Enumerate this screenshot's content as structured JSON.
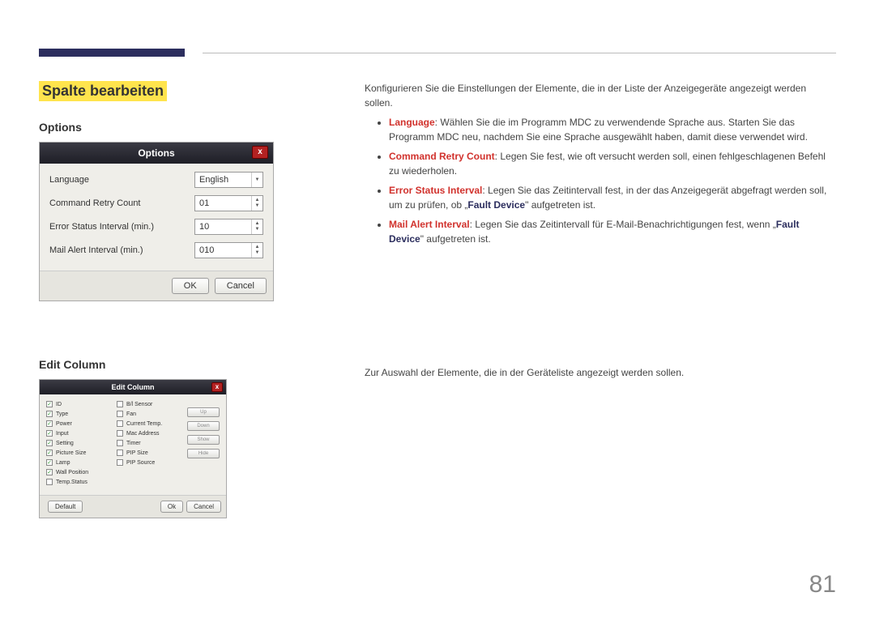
{
  "page": {
    "number": "81"
  },
  "headings": {
    "main": "Spalte bearbeiten",
    "options": "Options",
    "editcolumn": "Edit Column"
  },
  "dialogs": {
    "options": {
      "title": "Options",
      "rows": {
        "language_label": "Language",
        "language_value": "English",
        "retry_label": "Command Retry Count",
        "retry_value": "01",
        "errstatus_label": "Error Status Interval (min.)",
        "errstatus_value": "10",
        "mailalert_label": "Mail Alert Interval (min.)",
        "mailalert_value": "010"
      },
      "ok": "OK",
      "cancel": "Cancel"
    },
    "editcol": {
      "title": "Edit Column",
      "col1": [
        "ID",
        "Type",
        "Power",
        "Input",
        "Setting",
        "Picture Size",
        "Lamp",
        "Wall Position",
        "Temp.Status"
      ],
      "col1_checked": [
        true,
        true,
        true,
        true,
        true,
        true,
        true,
        true,
        false
      ],
      "col2": [
        "B/l Sensor",
        "Fan",
        "Current Temp.",
        "Mac Address",
        "Timer",
        "PIP Size",
        "PIP Source"
      ],
      "col2_checked": [
        false,
        false,
        false,
        false,
        false,
        false,
        false
      ],
      "btns": {
        "up": "Up",
        "down": "Down",
        "show": "Show",
        "hide": "Hide"
      },
      "default": "Default",
      "ok": "Ok",
      "cancel": "Cancel"
    }
  },
  "body": {
    "intro": "Konfigurieren Sie die Einstellungen der Elemente, die in der Liste der Anzeigegeräte angezeigt werden sollen.",
    "language_key": "Language",
    "language_text": ": Wählen Sie die im Programm MDC zu verwendende Sprache aus. Starten Sie das Programm MDC neu, nachdem Sie eine Sprache ausgewählt haben, damit diese verwendet wird.",
    "retry_key": "Command Retry Count",
    "retry_text": ": Legen Sie fest, wie oft versucht werden soll, einen fehlgeschlagenen Befehl zu wiederholen.",
    "errstatus_key": "Error Status Interval",
    "errstatus_text1": ": Legen Sie das Zeitintervall fest, in der das Anzeigegerät abgefragt werden soll, um zu prüfen, ob „",
    "errstatus_fault": "Fault Device",
    "errstatus_text2": "\" aufgetreten ist.",
    "mailalert_key": "Mail Alert Interval",
    "mailalert_text1": ": Legen Sie das Zeitintervall für E-Mail-Benachrichtigungen fest, wenn „",
    "mailalert_fault": "Fault Device",
    "mailalert_text2": "\" aufgetreten ist.",
    "editcol_desc": "Zur Auswahl der Elemente, die in der Geräteliste angezeigt werden sollen."
  }
}
